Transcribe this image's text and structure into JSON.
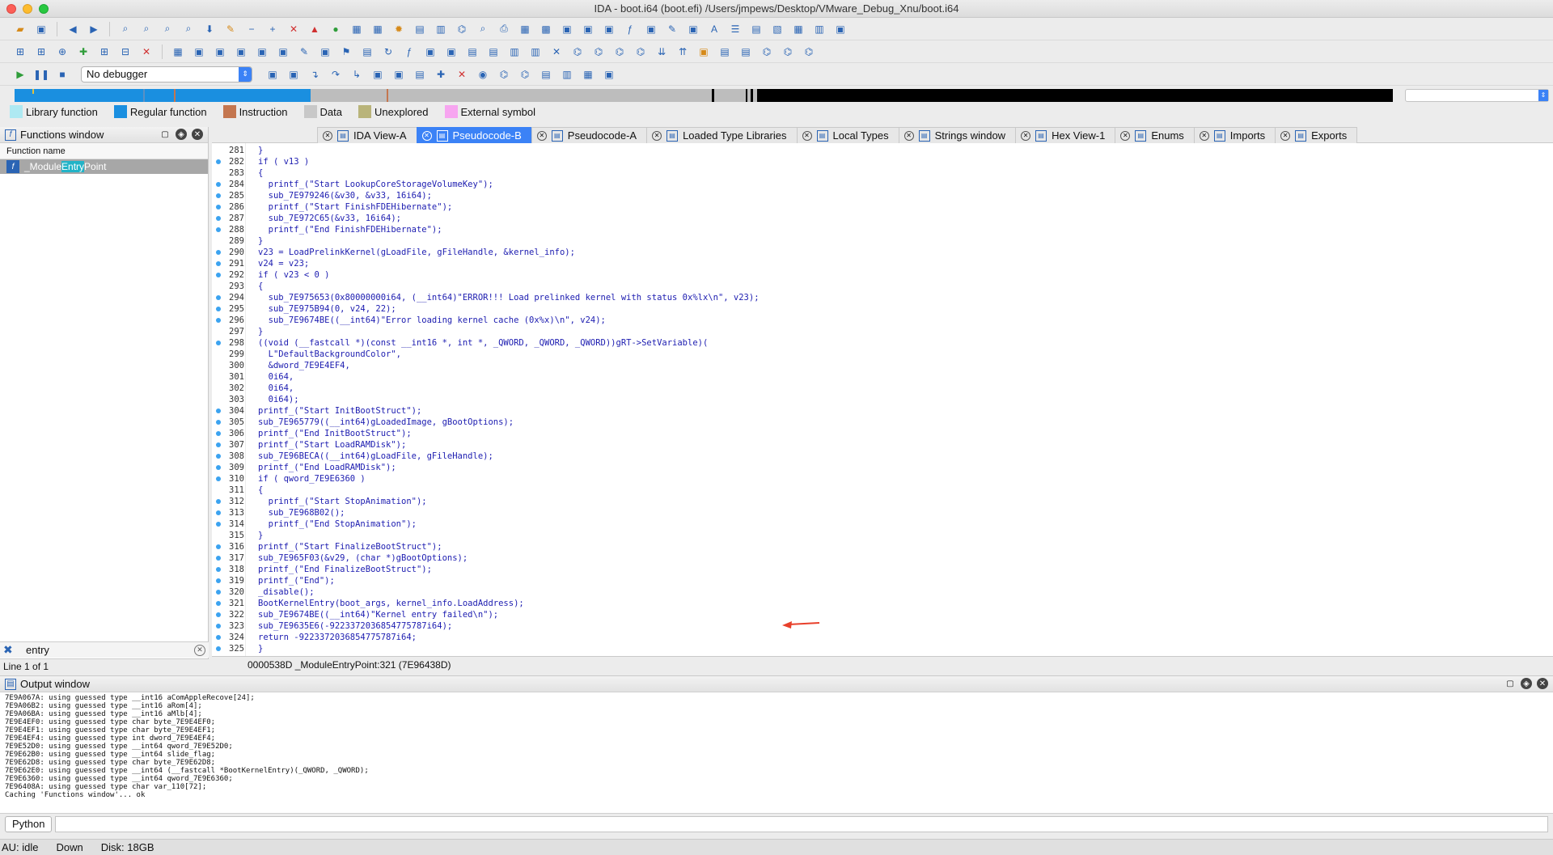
{
  "window": {
    "title": "IDA - boot.i64 (boot.efi) /Users/jmpews/Desktop/VMware_Debug_Xnu/boot.i64"
  },
  "debugger": {
    "selected": "No debugger"
  },
  "legend": [
    {
      "label": "Library function",
      "color": "#aee9f2"
    },
    {
      "label": "Regular function",
      "color": "#1a8fe0"
    },
    {
      "label": "Instruction",
      "color": "#c4764f"
    },
    {
      "label": "Data",
      "color": "#c8c8c8"
    },
    {
      "label": "Unexplored",
      "color": "#b9b47a"
    },
    {
      "label": "External symbol",
      "color": "#f7a5f0"
    }
  ],
  "functions_window": {
    "title": "Functions window",
    "column_header": "Function name",
    "items": [
      {
        "pre": "_Module",
        "match": "Entry",
        "post": "Point"
      }
    ],
    "filter_value": "entry",
    "line_status": "Line 1 of 1"
  },
  "tabs": [
    {
      "label": "IDA View-A",
      "icon": "ida-view-icon",
      "active": false
    },
    {
      "label": "Pseudocode-B",
      "icon": "pseudocode-icon",
      "active": true
    },
    {
      "label": "Pseudocode-A",
      "icon": "pseudocode-icon",
      "active": false
    },
    {
      "label": "Loaded Type Libraries",
      "icon": "library-icon",
      "active": false
    },
    {
      "label": "Local Types",
      "icon": "local-types-icon",
      "active": false
    },
    {
      "label": "Strings window",
      "icon": "strings-icon",
      "active": false
    },
    {
      "label": "Hex View-1",
      "icon": "hex-icon",
      "active": false
    },
    {
      "label": "Enums",
      "icon": "enums-icon",
      "active": false
    },
    {
      "label": "Imports",
      "icon": "imports-icon",
      "active": false
    },
    {
      "label": "Exports",
      "icon": "exports-icon",
      "active": false
    }
  ],
  "code": [
    {
      "n": "281",
      "dot": false,
      "t": "}"
    },
    {
      "n": "282",
      "dot": true,
      "t": "if ( v13 )"
    },
    {
      "n": "283",
      "dot": false,
      "t": "{"
    },
    {
      "n": "284",
      "dot": true,
      "t": "  printf_(\"Start LookupCoreStorageVolumeKey\");"
    },
    {
      "n": "285",
      "dot": true,
      "t": "  sub_7E979246(&v30, &v33, 16i64);"
    },
    {
      "n": "286",
      "dot": true,
      "t": "  printf_(\"Start FinishFDEHibernate\");"
    },
    {
      "n": "287",
      "dot": true,
      "t": "  sub_7E972C65(&v33, 16i64);"
    },
    {
      "n": "288",
      "dot": true,
      "t": "  printf_(\"End FinishFDEHibernate\");"
    },
    {
      "n": "289",
      "dot": false,
      "t": "}"
    },
    {
      "n": "290",
      "dot": true,
      "t": "v23 = LoadPrelinkKernel(gLoadFile, gFileHandle, &kernel_info);"
    },
    {
      "n": "291",
      "dot": true,
      "t": "v24 = v23;"
    },
    {
      "n": "292",
      "dot": true,
      "t": "if ( v23 < 0 )"
    },
    {
      "n": "293",
      "dot": false,
      "t": "{"
    },
    {
      "n": "294",
      "dot": true,
      "t": "  sub_7E975653(0x80000000i64, (__int64)\"ERROR!!! Load prelinked kernel with status 0x%lx\\n\", v23);"
    },
    {
      "n": "295",
      "dot": true,
      "t": "  sub_7E975B94(0, v24, 22);"
    },
    {
      "n": "296",
      "dot": true,
      "t": "  sub_7E9674BE((__int64)\"Error loading kernel cache (0x%x)\\n\", v24);"
    },
    {
      "n": "297",
      "dot": false,
      "t": "}"
    },
    {
      "n": "298",
      "dot": true,
      "t": "((void (__fastcall *)(const __int16 *, int *, _QWORD, _QWORD, _QWORD))gRT->SetVariable)("
    },
    {
      "n": "299",
      "dot": false,
      "t": "  L\"DefaultBackgroundColor\","
    },
    {
      "n": "300",
      "dot": false,
      "t": "  &dword_7E9E4EF4,"
    },
    {
      "n": "301",
      "dot": false,
      "t": "  0i64,"
    },
    {
      "n": "302",
      "dot": false,
      "t": "  0i64,"
    },
    {
      "n": "303",
      "dot": false,
      "t": "  0i64);"
    },
    {
      "n": "304",
      "dot": true,
      "t": "printf_(\"Start InitBootStruct\");"
    },
    {
      "n": "305",
      "dot": true,
      "t": "sub_7E965779((__int64)gLoadedImage, gBootOptions);"
    },
    {
      "n": "306",
      "dot": true,
      "t": "printf_(\"End InitBootStruct\");"
    },
    {
      "n": "307",
      "dot": true,
      "t": "printf_(\"Start LoadRAMDisk\");"
    },
    {
      "n": "308",
      "dot": true,
      "t": "sub_7E96BECA((__int64)gLoadFile, gFileHandle);"
    },
    {
      "n": "309",
      "dot": true,
      "t": "printf_(\"End LoadRAMDisk\");"
    },
    {
      "n": "310",
      "dot": true,
      "t": "if ( qword_7E9E6360 )"
    },
    {
      "n": "311",
      "dot": false,
      "t": "{"
    },
    {
      "n": "312",
      "dot": true,
      "t": "  printf_(\"Start StopAnimation\");"
    },
    {
      "n": "313",
      "dot": true,
      "t": "  sub_7E968B02();"
    },
    {
      "n": "314",
      "dot": true,
      "t": "  printf_(\"End StopAnimation\");"
    },
    {
      "n": "315",
      "dot": false,
      "t": "}"
    },
    {
      "n": "316",
      "dot": true,
      "t": "printf_(\"Start FinalizeBootStruct\");"
    },
    {
      "n": "317",
      "dot": true,
      "t": "sub_7E965F03(&v29, (char *)gBootOptions);"
    },
    {
      "n": "318",
      "dot": true,
      "t": "printf_(\"End FinalizeBootStruct\");"
    },
    {
      "n": "319",
      "dot": true,
      "t": "printf_(\"End\");"
    },
    {
      "n": "320",
      "dot": true,
      "t": "_disable();"
    },
    {
      "n": "321",
      "dot": true,
      "t": "BootKernelEntry(boot_args, kernel_info.LoadAddress);"
    },
    {
      "n": "322",
      "dot": true,
      "t": "sub_7E9674BE((__int64)\"Kernel entry failed\\n\");"
    },
    {
      "n": "323",
      "dot": true,
      "t": "sub_7E9635E6(-9223372036854775787i64);"
    },
    {
      "n": "324",
      "dot": true,
      "t": "return -9223372036854775787i64;"
    },
    {
      "n": "325",
      "dot": true,
      "t": "}"
    }
  ],
  "editor_status": "0000538D _ModuleEntryPoint:321 (7E96438D)",
  "output_window": {
    "title": "Output window",
    "lines": [
      "7E9A067A: using guessed type __int16 aComAppleRecove[24];",
      "7E9A06B2: using guessed type __int16 aRom[4];",
      "7E9A06BA: using guessed type __int16 aMlb[4];",
      "7E9E4EF0: using guessed type char byte_7E9E4EF0;",
      "7E9E4EF1: using guessed type char byte_7E9E4EF1;",
      "7E9E4EF4: using guessed type int dword_7E9E4EF4;",
      "7E9E52D0: using guessed type __int64 qword_7E9E52D0;",
      "7E9E62B0: using guessed type __int64 slide_flag;",
      "7E9E62D8: using guessed type char byte_7E9E62D8;",
      "7E9E62E0: using guessed type __int64 (__fastcall *BootKernelEntry)(_QWORD, _QWORD);",
      "7E9E6360: using guessed type __int64 qword_7E9E6360;",
      "7E96408A: using guessed type char var_110[72];",
      "Caching 'Functions window'... ok"
    ]
  },
  "python_button": "Python",
  "statusbar": {
    "au": "AU:  idle",
    "dir": "Down",
    "disk": "Disk: 18GB"
  },
  "navband_colors": {
    "regular": "#1a8fe0",
    "data": "#bdbdbd",
    "black": "#000000"
  }
}
